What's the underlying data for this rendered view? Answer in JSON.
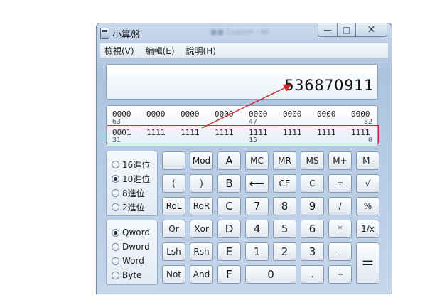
{
  "window": {
    "title": "小算盤",
    "title_blur": "■■ Custom - Wi"
  },
  "window_buttons": {
    "minimize": "—",
    "maximize": "□",
    "close": "✕"
  },
  "menu": [
    "檢視(V)",
    "編輯(E)",
    "說明(H)"
  ],
  "display": {
    "value": "536870911"
  },
  "bits": {
    "row1": [
      "0000",
      "0000",
      "0000",
      "0000",
      "0000",
      "0000",
      "0000",
      "0000"
    ],
    "row1_positions": [
      "63",
      "47",
      "32"
    ],
    "row2": [
      "0001",
      "1111",
      "1111",
      "1111",
      "1111",
      "1111",
      "1111",
      "1111"
    ],
    "row2_positions": [
      "31",
      "15",
      "0"
    ]
  },
  "base_options": [
    "16進位",
    "10進位",
    "8進位",
    "2進位"
  ],
  "base_selected": "10進位",
  "word_options": [
    "Qword",
    "Dword",
    "Word",
    "Byte"
  ],
  "word_selected": "Qword",
  "keys": {
    "blank": "",
    "mod": "Mod",
    "a": "A",
    "mc": "MC",
    "mr": "MR",
    "ms": "MS",
    "mplus": "M+",
    "mminus": "M-",
    "lparen": "(",
    "rparen": ")",
    "b": "B",
    "backspace": "⟵",
    "ce": "CE",
    "c_clear": "C",
    "plusminus": "±",
    "sqrt": "√",
    "rol": "RoL",
    "ror": "RoR",
    "c": "C",
    "seven": "7",
    "eight": "8",
    "nine": "9",
    "divide": "/",
    "percent": "%",
    "or": "Or",
    "xor": "Xor",
    "d": "D",
    "four": "4",
    "five": "5",
    "six": "6",
    "multiply": "*",
    "reciprocal": "1/x",
    "lsh": "Lsh",
    "rsh": "Rsh",
    "e": "E",
    "one": "1",
    "two": "2",
    "three": "3",
    "minus": "-",
    "equals": "=",
    "not": "Not",
    "and": "And",
    "f": "F",
    "zero": "0",
    "dot": ".",
    "plus": "+"
  },
  "colors": {
    "annotation": "#cc2a2a",
    "window_frame": "#aec4de"
  }
}
